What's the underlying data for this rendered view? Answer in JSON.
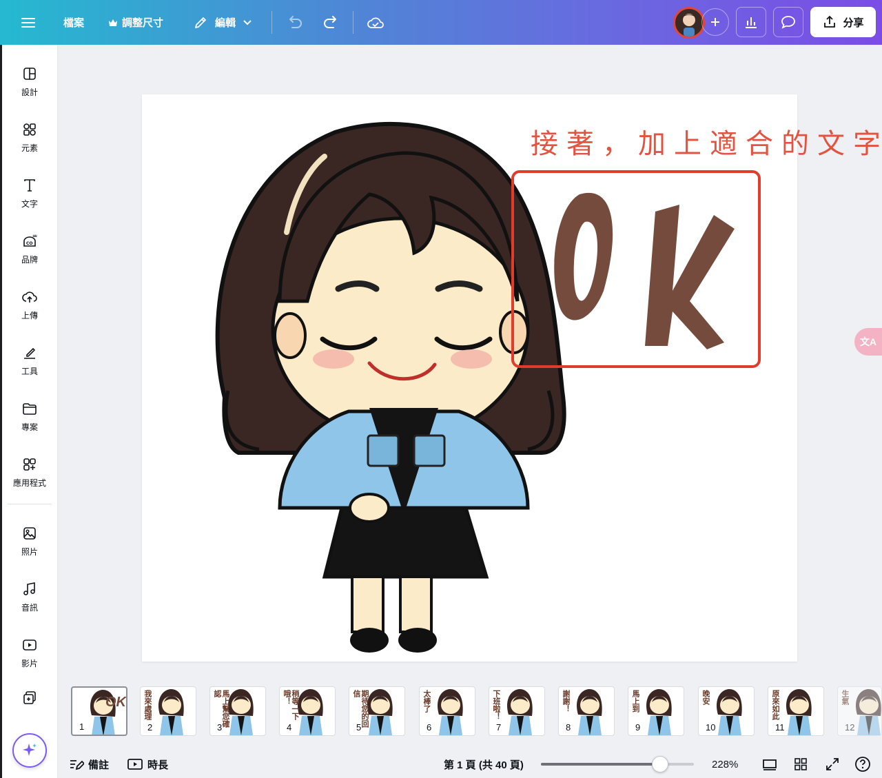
{
  "topbar": {
    "file_label": "檔案",
    "resize_label": "調整尺寸",
    "edit_label": "編輯",
    "share_label": "分享"
  },
  "sidebar": {
    "items": [
      {
        "label": "設計",
        "icon": "design-icon"
      },
      {
        "label": "元素",
        "icon": "elements-icon"
      },
      {
        "label": "文字",
        "icon": "text-icon"
      },
      {
        "label": "品牌",
        "icon": "brand-icon"
      },
      {
        "label": "上傳",
        "icon": "upload-icon"
      },
      {
        "label": "工具",
        "icon": "tools-icon"
      },
      {
        "label": "專案",
        "icon": "projects-icon"
      },
      {
        "label": "應用程式",
        "icon": "apps-icon"
      },
      {
        "label": "照片",
        "icon": "photos-icon"
      },
      {
        "label": "音訊",
        "icon": "audio-icon"
      },
      {
        "label": "影片",
        "icon": "video-icon"
      }
    ]
  },
  "canvas": {
    "annotation": "接著，加上適合的文字",
    "sticker_text": "OK"
  },
  "translate_badge": "文A",
  "thumbnails": [
    {
      "num": "1",
      "text": "OK"
    },
    {
      "num": "2",
      "text": "我來處理"
    },
    {
      "num": "3",
      "text": "馬上幫您確認"
    },
    {
      "num": "4",
      "text": "稍等一下哦！"
    },
    {
      "num": "5",
      "text": "期待您的回信"
    },
    {
      "num": "6",
      "text": "太棒了"
    },
    {
      "num": "7",
      "text": "下班啦！"
    },
    {
      "num": "8",
      "text": "謝謝！"
    },
    {
      "num": "9",
      "text": "馬上到"
    },
    {
      "num": "10",
      "text": "晚安"
    },
    {
      "num": "11",
      "text": "原來如此"
    },
    {
      "num": "12",
      "text": "生氣"
    }
  ],
  "bottombar": {
    "notes_label": "備註",
    "duration_label": "時長",
    "page_info": "第 1 頁 (共 40 頁)",
    "zoom_level": "228%",
    "zoom_fraction": 0.78
  },
  "colors": {
    "annotation": "#e2543f",
    "ok_text": "#754b3d",
    "highlight_box": "#e03c2e",
    "magic_accent": "#7d5af2"
  }
}
